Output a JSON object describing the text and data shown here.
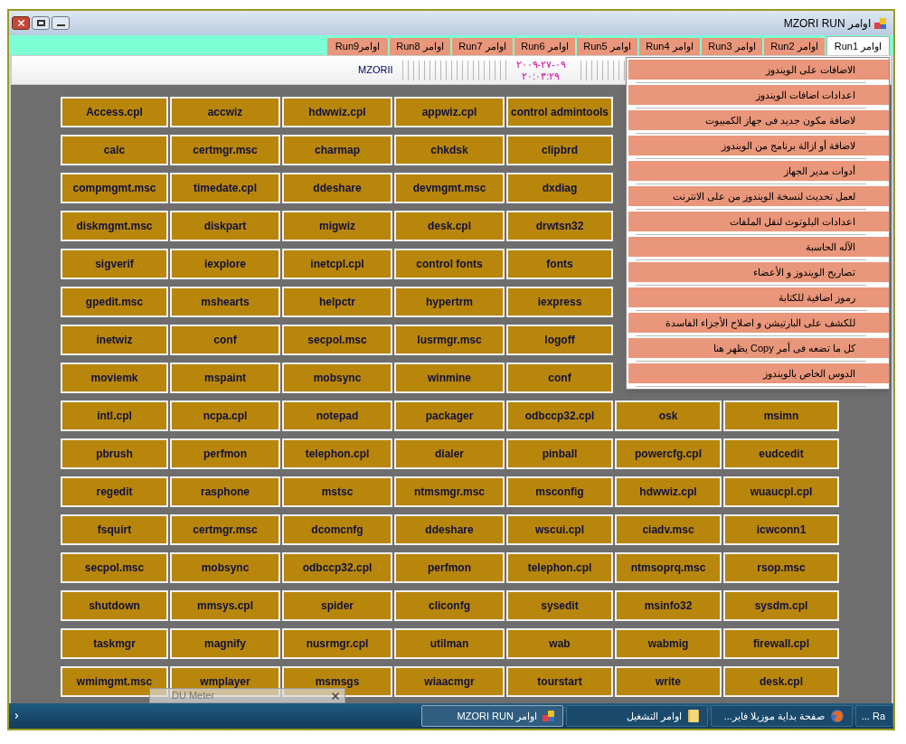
{
  "window": {
    "title": "اوامر MZORI RUN"
  },
  "tabs": [
    {
      "label": "اوامر Run1",
      "selected": true
    },
    {
      "label": "اوامر Run2",
      "selected": false
    },
    {
      "label": "اوامر Run3",
      "selected": false
    },
    {
      "label": "اوامر Run4",
      "selected": false
    },
    {
      "label": "اوامر Run5",
      "selected": false
    },
    {
      "label": "اوامر Run6",
      "selected": false
    },
    {
      "label": "اوامر Run7",
      "selected": false
    },
    {
      "label": "اوامر Run8",
      "selected": false
    },
    {
      "label": "اوامرRun9",
      "selected": false
    }
  ],
  "info_strip": {
    "label": "MZORII",
    "date": "٢٠٠٩-٢٧-٠٩",
    "time": "٢٠:٠٣:٢٩"
  },
  "grid": [
    [
      "Access.cpl",
      "accwiz",
      "hdwwiz.cpl",
      "appwiz.cpl",
      "control admintools"
    ],
    [
      "calc",
      "certmgr.msc",
      "charmap",
      "chkdsk",
      "clipbrd"
    ],
    [
      "compmgmt.msc",
      "timedate.cpl",
      "ddeshare",
      "devmgmt.msc",
      "dxdiag"
    ],
    [
      "diskmgmt.msc",
      "diskpart",
      "migwiz",
      "desk.cpl",
      "drwtsn32"
    ],
    [
      "sigverif",
      "iexplore",
      "inetcpl.cpl",
      "control fonts",
      "fonts"
    ],
    [
      "gpedit.msc",
      "mshearts",
      "helpctr",
      "hypertrm",
      "iexpress"
    ],
    [
      "inetwiz",
      "conf",
      "secpol.msc",
      "lusrmgr.msc",
      "logoff"
    ],
    [
      "moviemk",
      "mspaint",
      "mobsync",
      "winmine",
      "conf"
    ],
    [
      "intl.cpl",
      "ncpa.cpl",
      "notepad",
      "packager",
      "odbccp32.cpl",
      "osk",
      "msimn"
    ],
    [
      "pbrush",
      "perfmon",
      "telephon.cpl",
      "dialer",
      "pinball",
      "powercfg.cpl",
      "eudcedit"
    ],
    [
      "regedit",
      "rasphone",
      "mstsc",
      "ntmsmgr.msc",
      "msconfig",
      "hdwwiz.cpl",
      "wuaucpl.cpl"
    ],
    [
      "fsquirt",
      "certmgr.msc",
      "dcomcnfg",
      "ddeshare",
      "wscui.cpl",
      "ciadv.msc",
      "icwconn1"
    ],
    [
      "secpol.msc",
      "mobsync",
      "odbccp32.cpl",
      "perfmon",
      "telephon.cpl",
      "ntmsoprq.msc",
      "rsop.msc"
    ],
    [
      "shutdown",
      "mmsys.cpl",
      "spider",
      "cliconfg",
      "sysedit",
      "msinfo32",
      "sysdm.cpl"
    ],
    [
      "taskmgr",
      "magnify",
      "nusrmgr.cpl",
      "utilman",
      "wab",
      "wabmig",
      "firewall.cpl"
    ],
    [
      "wmimgmt.msc",
      "wmplayer",
      "msmsgs",
      "wiaacmgr",
      "tourstart",
      "write",
      "desk.cpl"
    ]
  ],
  "menu": [
    "الاضافات على الويندوز",
    "اعدادات اضافات الويندوز",
    "لاضافة مكون جديد فى جهاز الكمبيوت",
    "لاضافة أو ازالة برنامج من الويندوز",
    "أدوات مدير الجهاز",
    "لعمل تحديث لنسخة الويندوز من على الانترنت",
    "اعدادات البلوتوث لنقل الملفات",
    "الآله الحاسبة",
    "تصاريح الويندوز و الأعضاء",
    "رموز اضافية للكتابة",
    "للكشف على البارتيشن و اصلاح الأجزاء الفاسدة",
    "كل ما تضعه فى أمر Copy يظهر هنا",
    "الدوس الخاص بالويندوز"
  ],
  "overlay_window": {
    "title": "DU Meter"
  },
  "taskbar": [
    {
      "label": "اوامر MZORI RUN",
      "kind": "app",
      "selected": true
    },
    {
      "label": "اوامر التشغيل",
      "kind": "folder",
      "selected": false
    },
    {
      "label": "صفحة بداية موزيلا فاير...",
      "kind": "browser",
      "selected": false
    },
    {
      "label": "Ra ...",
      "kind": "none",
      "selected": false
    }
  ]
}
